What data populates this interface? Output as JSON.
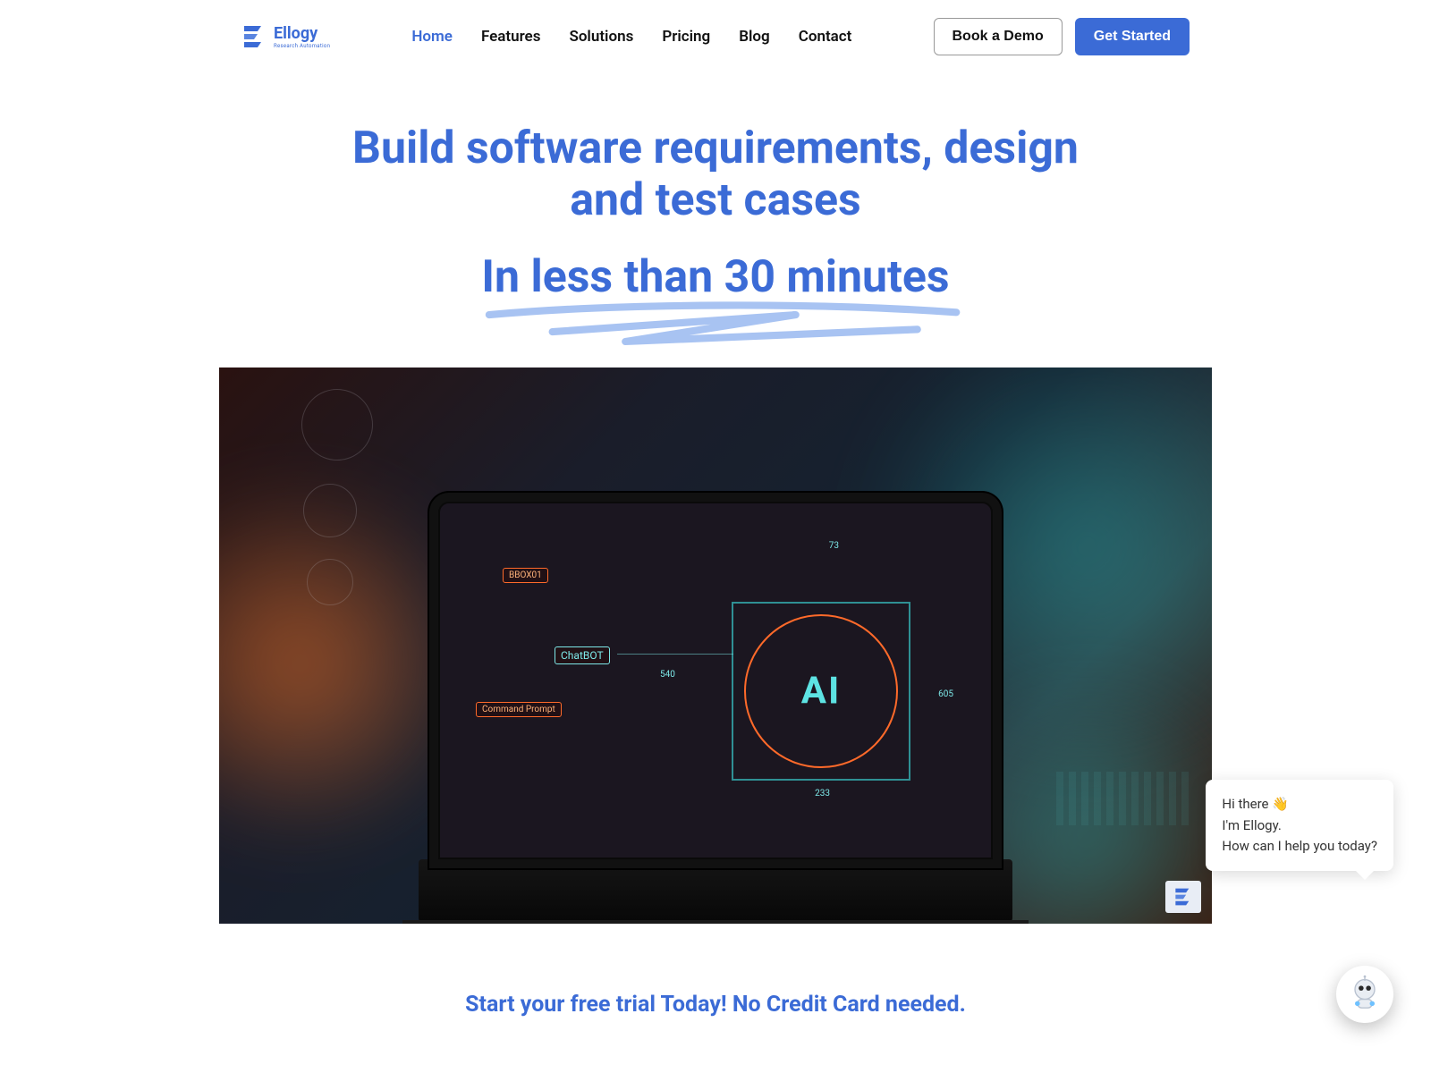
{
  "brand": {
    "name": "Ellogy",
    "tagline": "Research Automation"
  },
  "nav": {
    "items": [
      {
        "label": "Home",
        "active": true
      },
      {
        "label": "Features",
        "active": false
      },
      {
        "label": "Solutions",
        "active": false
      },
      {
        "label": "Pricing",
        "active": false
      },
      {
        "label": "Blog",
        "active": false
      },
      {
        "label": "Contact",
        "active": false
      }
    ]
  },
  "header": {
    "book_demo": "Book a Demo",
    "get_started": "Get Started"
  },
  "hero": {
    "title": "Build software requirements, design and test cases",
    "subtitle": "In less than 30 minutes"
  },
  "media": {
    "chip_bbox": "BBOX01",
    "chip_chatbot": "ChatBOT",
    "chip_cmd": "Command Prompt",
    "ai_label": "AI",
    "num1": "73",
    "num2": "540",
    "num3": "605",
    "num4": "233"
  },
  "cta": {
    "line": "Start your free trial Today! No Credit Card needed."
  },
  "chat": {
    "line1": "Hi there 👋",
    "line2": "I'm Ellogy.",
    "line3": "How can I help you today?"
  },
  "colors": {
    "primary": "#3b6bd6"
  }
}
